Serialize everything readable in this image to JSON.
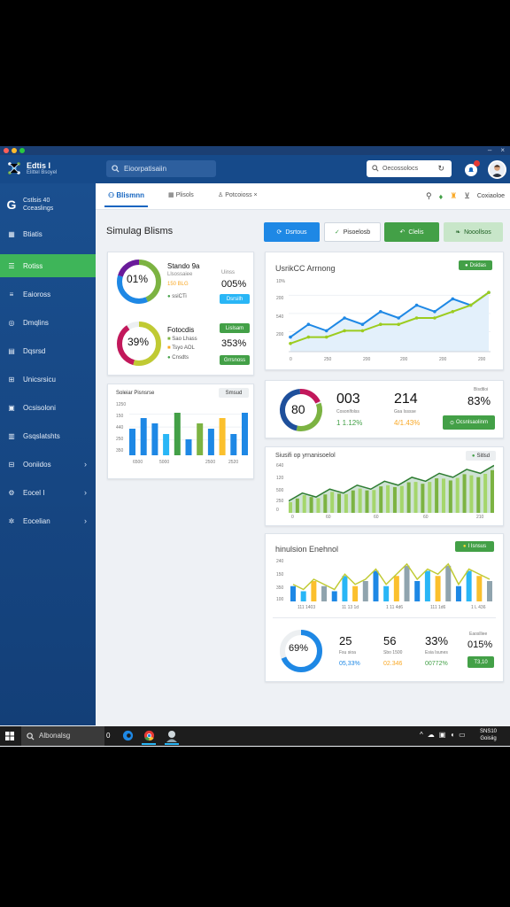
{
  "window": {
    "controls": [
      "–",
      "×"
    ],
    "colors": {
      "red": "#ff5f57",
      "yellow": "#febc2e",
      "green": "#28c840"
    }
  },
  "topbar": {
    "brand_title": "Edtis I",
    "brand_subtitle": "Elittel Bsoyel",
    "search_placeholder": "Eioorpatisaiin",
    "right_search_placeholder": "Oecossolocs",
    "right_search_icon": "refresh-icon",
    "notification_icon": "bell-icon"
  },
  "sidebar": {
    "header_line1": "Cstlsis 40",
    "header_line2": "Cceaslings",
    "items": [
      {
        "label": "Btiatis",
        "icon": "grid-icon",
        "chevron": false
      },
      {
        "label": "Rotiss",
        "icon": "menu-icon",
        "chevron": false,
        "active": true
      },
      {
        "label": "Eaioross",
        "icon": "list-icon",
        "chevron": false
      },
      {
        "label": "Dmqlins",
        "icon": "target-icon",
        "chevron": false
      },
      {
        "label": "Dqsrsd",
        "icon": "inbox-icon",
        "chevron": false
      },
      {
        "label": "Unicsrsicu",
        "icon": "box-icon",
        "chevron": false
      },
      {
        "label": "Ocsisoloni",
        "icon": "window-icon",
        "chevron": false
      },
      {
        "label": "Gsqslatshts",
        "icon": "doc-icon",
        "chevron": false
      },
      {
        "label": "Ooniidos",
        "icon": "sliders-icon",
        "chevron": true
      },
      {
        "label": "Eocel I",
        "icon": "settings-icon",
        "chevron": true
      },
      {
        "label": "Eocelian",
        "icon": "gear-icon",
        "chevron": true
      }
    ]
  },
  "tabs": [
    {
      "label": "Blismnn",
      "active": true
    },
    {
      "label": "Plisols"
    },
    {
      "label": "Potcoioss"
    }
  ],
  "tabbar_right": {
    "label": "Coxiaoloe"
  },
  "page_title": "Simulag Blisms",
  "action_buttons": [
    {
      "label": "Dsrtous",
      "style": "blue"
    },
    {
      "label": "Pisoelosb",
      "style": "white"
    },
    {
      "label": "Clelis",
      "style": "green"
    },
    {
      "label": "Nooollsos",
      "style": "lightgreen"
    }
  ],
  "card1": {
    "row1": {
      "ring": "01%",
      "title": "Stando 9a",
      "line2": "Llsossaiee",
      "line3": "150 BLG",
      "line4": "ssiCTi",
      "mid": "Uinss",
      "value": "005%",
      "pill": "Dsrsilh"
    },
    "row2": {
      "ring": "39%",
      "title": "Fotocdis",
      "line2": "Sao Lhass",
      "line3": "Tsyo AOL",
      "line4": "Cnsdts",
      "value": "353%",
      "pill_top": "Lislsam",
      "pill_bottom": "Grrsnoss"
    }
  },
  "card2": {
    "title": "Soleiar Pisnsrse",
    "pill": "Smsud",
    "ticks_y": [
      "1250",
      "150",
      "440",
      "250",
      "350"
    ],
    "ticks_x": [
      "6500",
      "5000",
      "2500",
      "2520"
    ]
  },
  "card3": {
    "title": "UsrikCC Arrnong",
    "pill": "Dsidas",
    "ticks_y": [
      "10%",
      "200",
      "540",
      "200"
    ],
    "ticks_x": [
      "0",
      "250",
      "200",
      "200",
      "200",
      "200"
    ]
  },
  "card4": {
    "ring": "80",
    "v1": "003",
    "v1_sub": "Cosonlfolss",
    "v1_foot": "1 1.12%",
    "v2": "214",
    "v2_sub": "Gsa Isssse",
    "v2_foot": "4/1.43%",
    "top_right": "Bisdtloi",
    "v3": "83%",
    "pill": "Ocsnlsaolinm"
  },
  "card5": {
    "title": "Siusifi op yrnanisoelol",
    "pill": "Sitlsd",
    "ticks_y": [
      "640",
      "120",
      "500",
      "250",
      "0"
    ],
    "ticks_x": [
      "0",
      "60",
      "60",
      "60",
      "210"
    ]
  },
  "card6": {
    "title": "hinulsion Enehnol",
    "pill": "I Isnsus",
    "ticks_y": [
      "240",
      "150",
      "350",
      "100"
    ],
    "ticks_x": [
      "111 1403",
      "11 13 1d",
      "1 11 4d6",
      "111 1d6",
      "1 L 436"
    ],
    "ring": "69%",
    "stats": [
      {
        "value": "25",
        "sub": "Fsu sioa",
        "foot": "05,33%"
      },
      {
        "value": "56",
        "sub": "Sbo 1500",
        "foot": "02.346"
      },
      {
        "value": "33%",
        "sub": "Esia Isunes",
        "foot": "00772%"
      }
    ],
    "side_top": "Eaoslliee",
    "side_value": "015%",
    "side_pill": "T3,10"
  },
  "chart_data": [
    {
      "type": "line",
      "series": [
        {
          "values": [
            2,
            4,
            3,
            5,
            4,
            6,
            5,
            7,
            6,
            8,
            7,
            9
          ]
        },
        {
          "values": [
            1,
            2,
            2,
            3,
            3,
            4,
            4,
            5,
            5,
            6,
            7,
            9
          ]
        }
      ]
    },
    {
      "type": "bar",
      "values": [
        5,
        7,
        6,
        4,
        8,
        3,
        6,
        5,
        7,
        4,
        8
      ],
      "colors": [
        "#1e88e5",
        "#1e88e5",
        "#1e88e5",
        "#29b6f6",
        "#43a047",
        "#1e88e5",
        "#7cb342",
        "#1e88e5",
        "#fbc02d",
        "#1e88e5",
        "#1e88e5"
      ]
    },
    {
      "type": "area",
      "values": [
        3,
        5,
        4,
        6,
        5,
        7,
        6,
        8,
        7,
        9,
        8,
        10,
        9,
        11,
        10,
        12
      ]
    },
    {
      "type": "bar",
      "values": [
        3,
        2,
        4,
        3,
        2,
        5,
        3,
        4,
        6,
        3,
        5,
        7,
        4,
        6,
        5,
        7,
        3,
        6,
        5,
        4
      ]
    }
  ],
  "taskbar": {
    "search": "Albonalsg",
    "counter": "0",
    "time_line1": "SNS10",
    "time_line2": "Goisiig"
  }
}
